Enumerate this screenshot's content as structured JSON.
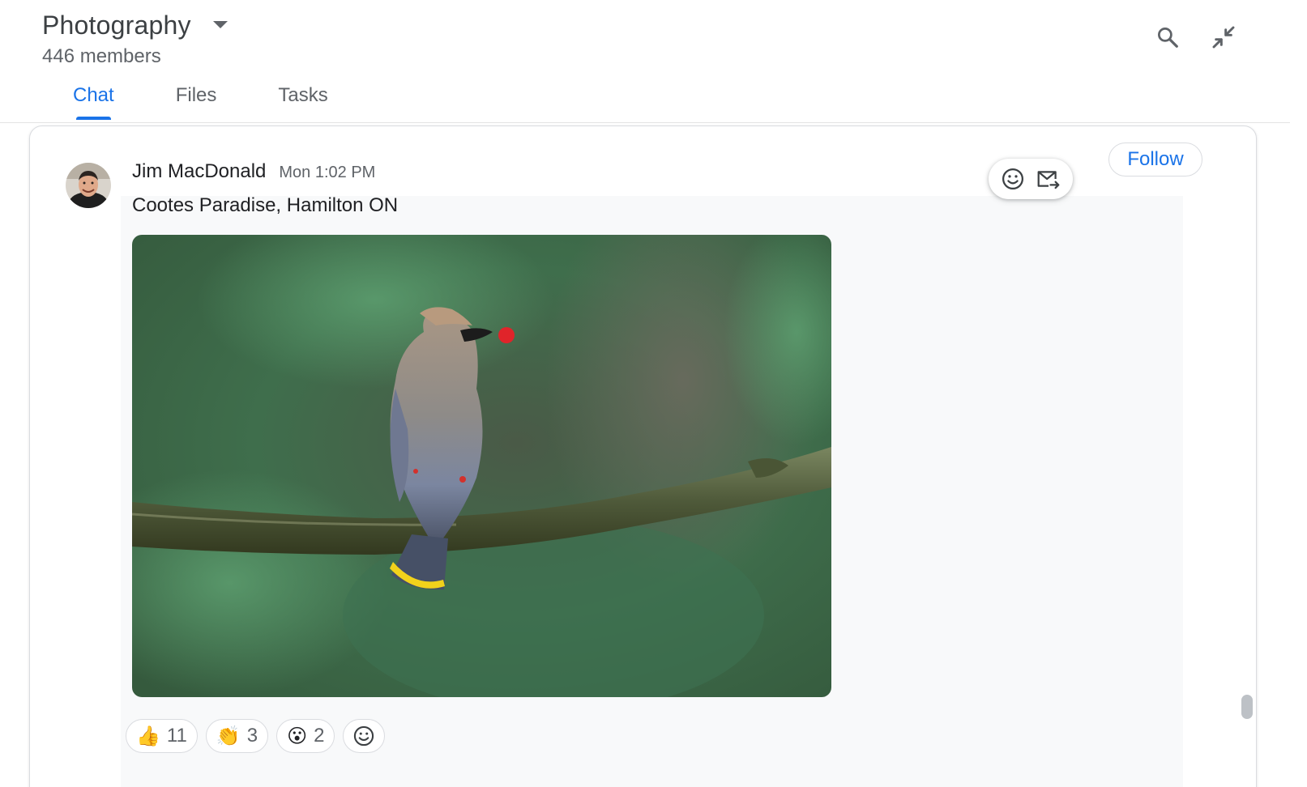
{
  "header": {
    "title": "Photography",
    "members": "446 members",
    "icons": {
      "dropdown": "arrow-drop-down-icon",
      "search": "search-icon",
      "collapse": "collapse-icon"
    }
  },
  "tabs": [
    {
      "label": "Chat",
      "active": true
    },
    {
      "label": "Files",
      "active": false
    },
    {
      "label": "Tasks",
      "active": false
    }
  ],
  "message": {
    "sender": "Jim MacDonald",
    "time": "Mon 1:02 PM",
    "text": "Cootes Paradise, Hamilton ON",
    "follow_label": "Follow",
    "actions": {
      "react": "add-reaction-icon",
      "forward": "forward-to-inbox-icon"
    },
    "reactions": [
      {
        "emoji": "👍",
        "icon": "thumbs-up-emoji",
        "count": "11"
      },
      {
        "emoji": "👏",
        "icon": "clapping-hands-emoji",
        "count": "3"
      },
      {
        "emoji": "😮",
        "icon": "surprised-face-emoji",
        "count": "2"
      }
    ],
    "add_reaction": "add-reaction-icon"
  },
  "colors": {
    "accent": "#1a73e8",
    "text_primary": "#202124",
    "text_secondary": "#5f6368",
    "border": "#dadce0"
  }
}
